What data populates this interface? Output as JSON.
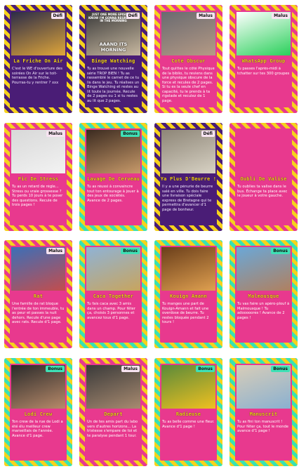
{
  "cards": [
    {
      "type": "defi",
      "badge": "Défi",
      "title": "La Friche On Air",
      "desc": "C'est le WE d'ouverture des soirées On Air sur le toit-terrasse de la Friche. Pourras-tu y rentrer ? xxx",
      "photo": [
        "#2b2b48",
        "#e0a63a"
      ]
    },
    {
      "type": "defi",
      "badge": "Défi",
      "title": "Binge Watching",
      "desc": "Tu as trouvé une nouvelle série TROP BIEN ! Tu as rassemblé le carnet de ce tu lis dans le jeu. Tu réalises un Binge Watching et restes au lit toute la journée. Recule de 2 pages ou 1 si tu restes au lit que 2 pages.",
      "photo": [
        "#3a3a3a",
        "#c8b8a0"
      ],
      "meme": [
        "JUST ONE MORE EPISODE, I KNOW I'M GONNA REGRET THIS IN THE MORNING",
        "AAAND ITS MORNING"
      ]
    },
    {
      "type": "malus",
      "badge": "Malus",
      "title": "Coté Obscur",
      "desc": "Tout quittes le côté Physique de la biblio, tu reviens dans une physique obscure de la force et recules de 2 pages. Si tu es la seule chef en capacité, tu le prends à ta rigolade et reculez de 1 page.",
      "photo": [
        "#6a6a70",
        "#b59a85"
      ]
    },
    {
      "type": "malus",
      "badge": "Malus",
      "title": "WhatsApp Group",
      "desc": "Tu passes l'après-midi à tchatter sur tes 300 groupes",
      "photo": [
        "#ffffff",
        "#2ad05a"
      ]
    },
    {
      "type": "malus",
      "badge": "Malus",
      "title": "Pic De Stress",
      "desc": "Tu as un retard de règle... Stress ou vraie grossesse ? Tu perds 10 jours à te poser des questions. Recule de trois pages !",
      "photo": [
        "#d8d8d8",
        "#f3f3f3"
      ]
    },
    {
      "type": "bonus",
      "badge": "Bonus",
      "title": "Lavage De Cerveau",
      "desc": "Tu as réussi à convaincre tout ton entourage à jouer à des jeux de sociétés. Avance de 2 pages.",
      "photo": [
        "#3b2a20",
        "#c89a6a"
      ]
    },
    {
      "type": "defi",
      "badge": "Défi",
      "title": "Ya Plus D'Beurre !",
      "desc": "Il y a une pénurie de beurre salé en ville. Tu dois faire une livraison spéciale express de Bretagne qui te permettra d'avancer d'1 page de bonheur.",
      "photo": [
        "#8d8577",
        "#d8d2c4"
      ]
    },
    {
      "type": "malus",
      "badge": "",
      "title": "Oubli De Valise",
      "desc": "Tu oublies ta valise dans le bus. Échange ta place avec le joueur à votre gauche.",
      "photo": [
        "#e8398e",
        "#e8398e"
      ]
    },
    {
      "type": "malus",
      "badge": "Malus",
      "title": "Rat",
      "desc": "Une famille de rat bloque l'entrée de ton immeuble, tu as peur et passes la nuit dehors. Recule d'une page avec rats. Recule d'1 page.",
      "photo": [
        "#3b6fb8",
        "#c44d4d"
      ]
    },
    {
      "type": "bonus",
      "badge": "Bonus",
      "title": "Caca Together",
      "desc": "Tu fais caca avec 3 amis dans un champ. Pour fêter ça, choisis 3 personnes et avancez tous d'1 page.",
      "photo": [
        "#8fb3d6",
        "#c8a45e"
      ]
    },
    {
      "type": "bonus",
      "badge": "",
      "title": "Kouign Amann",
      "desc": "Tu manges une part de Kouign-Amann et fait une overdose de beurre. Tu restes bloquée pendant 2 tours !",
      "photo": [
        "#6a3e1a",
        "#e0a050"
      ]
    },
    {
      "type": "bonus",
      "badge": "Bonus",
      "title": "Malmousque",
      "desc": "Tu vas faire un apéro-plouf à Malmousque ! Tu adooooores ! Avance de 2 pages !",
      "photo": [
        "#6aa8d8",
        "#b08060"
      ]
    },
    {
      "type": "bonus",
      "badge": "Bonus",
      "title": "Lodi Crew",
      "desc": "Ton crew de la rue de Lodi a été élu meilleur crew marseillais de l'année. Avance d'1 page.",
      "photo": [
        "#2a2a2a",
        "#b88a6a"
      ]
    },
    {
      "type": "malus",
      "badge": "Malus",
      "title": "Depart",
      "desc": "Un de tes amis part du labo vers d'autres horizons... La tristesse s'empare de toi et te paralyse pendant 1 tour.",
      "photo": [
        "#3a3a3a",
        "#a88a70"
      ]
    },
    {
      "type": "bonus",
      "badge": "Bonus",
      "title": "Radieuse",
      "desc": "Tu as belle comme une fleur. Avance d'1 page !",
      "photo": [
        "#5a8a3a",
        "#f0c020"
      ]
    },
    {
      "type": "bonus",
      "badge": "Bonus",
      "title": "Manuscrit",
      "desc": "Tu as fini ton manuscrit ! Pour fêter ça, tout le monde avance d'1 page !",
      "photo": [
        "#d8cdb8",
        "#8ab0d0"
      ]
    }
  ]
}
